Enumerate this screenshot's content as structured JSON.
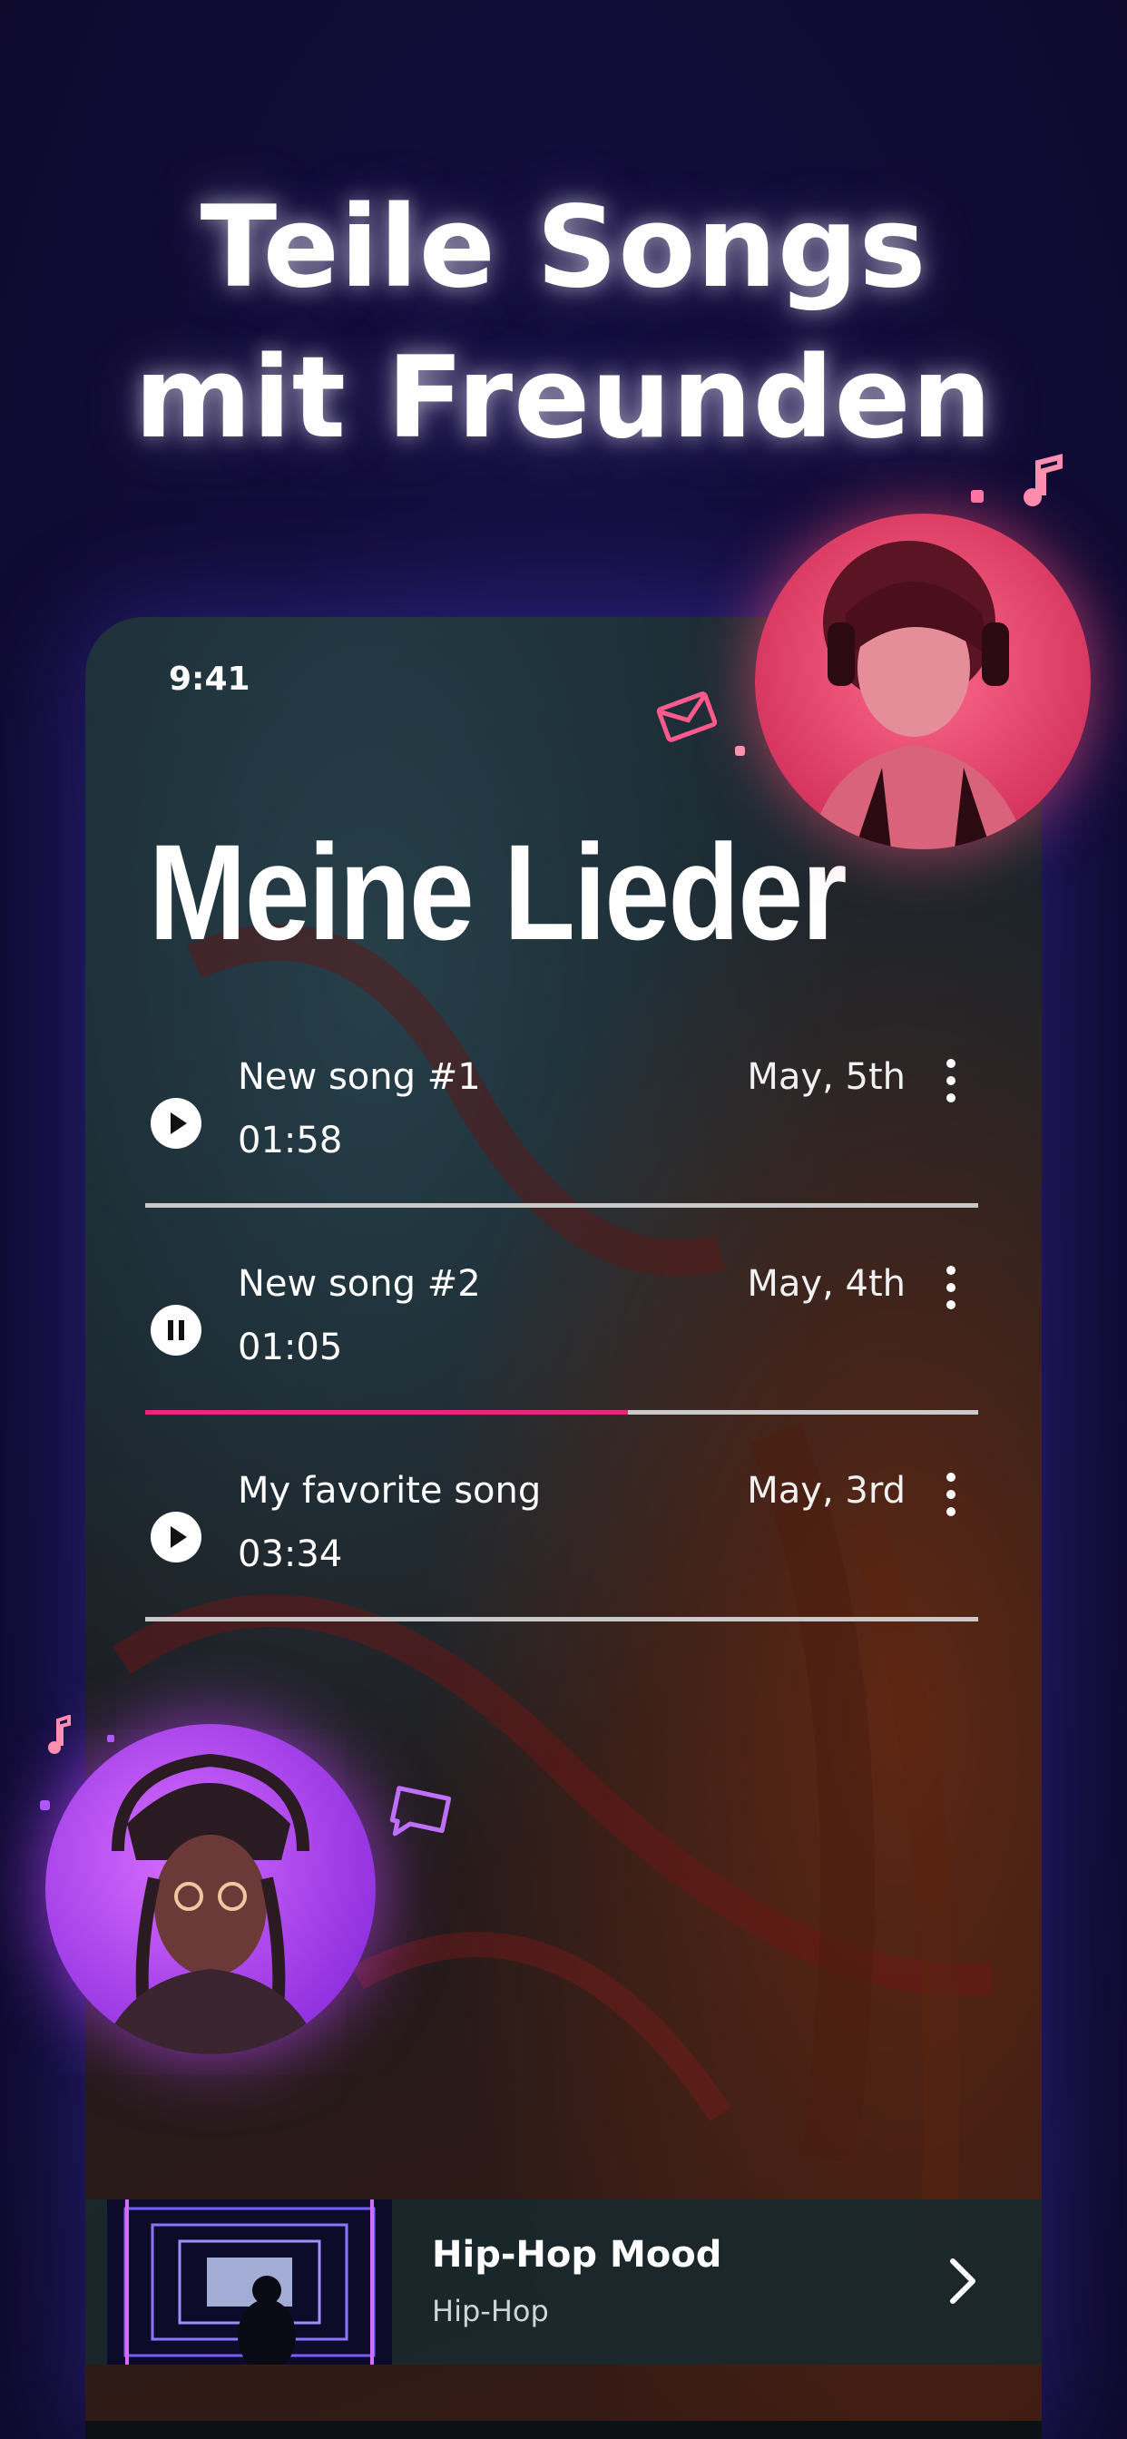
{
  "headline": {
    "line1": "Teile Songs",
    "line2": "mit Freunden"
  },
  "status_bar": {
    "time": "9:41"
  },
  "screen_title": "Meine Lieder",
  "songs": [
    {
      "title": "New song #1",
      "duration": "01:58",
      "date": "May, 5th",
      "state": "play",
      "progress": 0
    },
    {
      "title": "New song #2",
      "duration": "01:05",
      "date": "May, 4th",
      "state": "pause",
      "progress": 0.58
    },
    {
      "title": "My favorite song",
      "duration": "03:34",
      "date": "May, 3rd",
      "state": "play",
      "progress": 0
    }
  ],
  "now_playing": {
    "title": "Hip-Hop Mood",
    "genre": "Hip-Hop"
  },
  "colors": {
    "background": "#120c3a",
    "accent_pink": "#e8267f",
    "avatar_top_glow": "#ff5078",
    "avatar_bottom_glow": "#be46ff"
  },
  "icons": [
    "play-icon",
    "pause-icon",
    "more-vertical-icon",
    "chevron-right-icon",
    "envelope-icon",
    "chat-bubble-icon",
    "music-note-icon"
  ]
}
